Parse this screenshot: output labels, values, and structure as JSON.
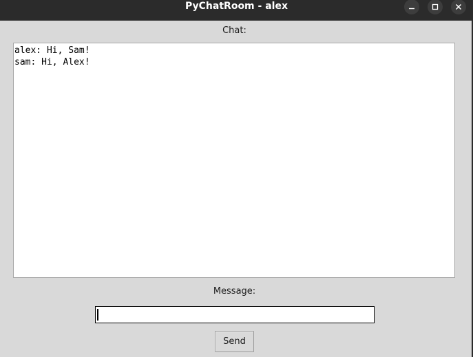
{
  "window": {
    "title": "PyChatRoom - alex",
    "controls": {
      "minimize": "minimize-icon",
      "maximize": "maximize-icon",
      "close": "close-icon"
    }
  },
  "chat": {
    "label": "Chat:",
    "messages": [
      "alex: Hi, Sam!",
      "sam: Hi, Alex!"
    ]
  },
  "message": {
    "label": "Message:",
    "value": "",
    "placeholder": ""
  },
  "send": {
    "label": "Send"
  },
  "colors": {
    "titlebar": "#2b2b2b",
    "background": "#d9d9d9",
    "chat_background": "#ffffff"
  }
}
